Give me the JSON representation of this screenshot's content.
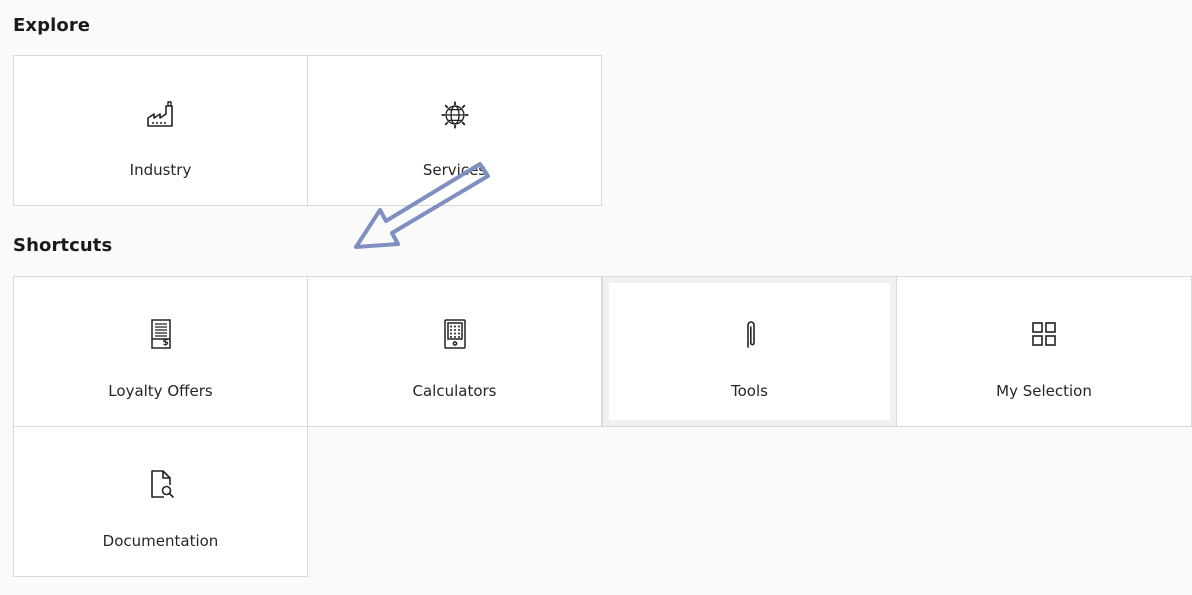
{
  "explore": {
    "title": "Explore",
    "tiles": [
      {
        "label": "Industry",
        "icon": "factory-icon"
      },
      {
        "label": "Services",
        "icon": "globe-gear-icon"
      }
    ]
  },
  "shortcuts": {
    "title": "Shortcuts",
    "tiles": [
      {
        "label": "Loyalty Offers",
        "icon": "price-list-icon"
      },
      {
        "label": "Calculators",
        "icon": "calculator-icon"
      },
      {
        "label": "Tools",
        "icon": "paperclip-icon"
      },
      {
        "label": "My Selection",
        "icon": "grid-icon"
      },
      {
        "label": "Documentation",
        "icon": "document-search-icon"
      }
    ]
  },
  "colors": {
    "background": "#fafafa",
    "tile": "#ffffff",
    "border": "#d9d9d9",
    "annotation_arrow": "#7f8fc2"
  }
}
